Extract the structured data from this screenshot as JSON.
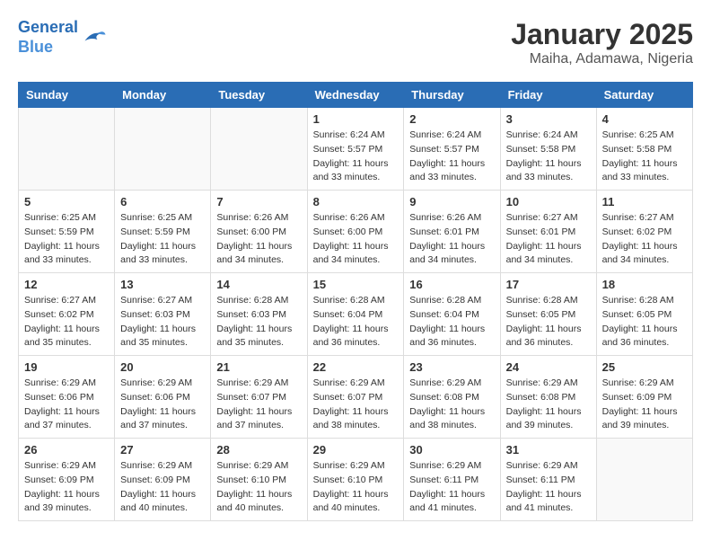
{
  "header": {
    "logo_line1": "General",
    "logo_line2": "Blue",
    "month_title": "January 2025",
    "location": "Maiha, Adamawa, Nigeria"
  },
  "days_of_week": [
    "Sunday",
    "Monday",
    "Tuesday",
    "Wednesday",
    "Thursday",
    "Friday",
    "Saturday"
  ],
  "weeks": [
    [
      {
        "day": "",
        "info": ""
      },
      {
        "day": "",
        "info": ""
      },
      {
        "day": "",
        "info": ""
      },
      {
        "day": "1",
        "info": "Sunrise: 6:24 AM\nSunset: 5:57 PM\nDaylight: 11 hours and 33 minutes."
      },
      {
        "day": "2",
        "info": "Sunrise: 6:24 AM\nSunset: 5:57 PM\nDaylight: 11 hours and 33 minutes."
      },
      {
        "day": "3",
        "info": "Sunrise: 6:24 AM\nSunset: 5:58 PM\nDaylight: 11 hours and 33 minutes."
      },
      {
        "day": "4",
        "info": "Sunrise: 6:25 AM\nSunset: 5:58 PM\nDaylight: 11 hours and 33 minutes."
      }
    ],
    [
      {
        "day": "5",
        "info": "Sunrise: 6:25 AM\nSunset: 5:59 PM\nDaylight: 11 hours and 33 minutes."
      },
      {
        "day": "6",
        "info": "Sunrise: 6:25 AM\nSunset: 5:59 PM\nDaylight: 11 hours and 33 minutes."
      },
      {
        "day": "7",
        "info": "Sunrise: 6:26 AM\nSunset: 6:00 PM\nDaylight: 11 hours and 34 minutes."
      },
      {
        "day": "8",
        "info": "Sunrise: 6:26 AM\nSunset: 6:00 PM\nDaylight: 11 hours and 34 minutes."
      },
      {
        "day": "9",
        "info": "Sunrise: 6:26 AM\nSunset: 6:01 PM\nDaylight: 11 hours and 34 minutes."
      },
      {
        "day": "10",
        "info": "Sunrise: 6:27 AM\nSunset: 6:01 PM\nDaylight: 11 hours and 34 minutes."
      },
      {
        "day": "11",
        "info": "Sunrise: 6:27 AM\nSunset: 6:02 PM\nDaylight: 11 hours and 34 minutes."
      }
    ],
    [
      {
        "day": "12",
        "info": "Sunrise: 6:27 AM\nSunset: 6:02 PM\nDaylight: 11 hours and 35 minutes."
      },
      {
        "day": "13",
        "info": "Sunrise: 6:27 AM\nSunset: 6:03 PM\nDaylight: 11 hours and 35 minutes."
      },
      {
        "day": "14",
        "info": "Sunrise: 6:28 AM\nSunset: 6:03 PM\nDaylight: 11 hours and 35 minutes."
      },
      {
        "day": "15",
        "info": "Sunrise: 6:28 AM\nSunset: 6:04 PM\nDaylight: 11 hours and 36 minutes."
      },
      {
        "day": "16",
        "info": "Sunrise: 6:28 AM\nSunset: 6:04 PM\nDaylight: 11 hours and 36 minutes."
      },
      {
        "day": "17",
        "info": "Sunrise: 6:28 AM\nSunset: 6:05 PM\nDaylight: 11 hours and 36 minutes."
      },
      {
        "day": "18",
        "info": "Sunrise: 6:28 AM\nSunset: 6:05 PM\nDaylight: 11 hours and 36 minutes."
      }
    ],
    [
      {
        "day": "19",
        "info": "Sunrise: 6:29 AM\nSunset: 6:06 PM\nDaylight: 11 hours and 37 minutes."
      },
      {
        "day": "20",
        "info": "Sunrise: 6:29 AM\nSunset: 6:06 PM\nDaylight: 11 hours and 37 minutes."
      },
      {
        "day": "21",
        "info": "Sunrise: 6:29 AM\nSunset: 6:07 PM\nDaylight: 11 hours and 37 minutes."
      },
      {
        "day": "22",
        "info": "Sunrise: 6:29 AM\nSunset: 6:07 PM\nDaylight: 11 hours and 38 minutes."
      },
      {
        "day": "23",
        "info": "Sunrise: 6:29 AM\nSunset: 6:08 PM\nDaylight: 11 hours and 38 minutes."
      },
      {
        "day": "24",
        "info": "Sunrise: 6:29 AM\nSunset: 6:08 PM\nDaylight: 11 hours and 39 minutes."
      },
      {
        "day": "25",
        "info": "Sunrise: 6:29 AM\nSunset: 6:09 PM\nDaylight: 11 hours and 39 minutes."
      }
    ],
    [
      {
        "day": "26",
        "info": "Sunrise: 6:29 AM\nSunset: 6:09 PM\nDaylight: 11 hours and 39 minutes."
      },
      {
        "day": "27",
        "info": "Sunrise: 6:29 AM\nSunset: 6:09 PM\nDaylight: 11 hours and 40 minutes."
      },
      {
        "day": "28",
        "info": "Sunrise: 6:29 AM\nSunset: 6:10 PM\nDaylight: 11 hours and 40 minutes."
      },
      {
        "day": "29",
        "info": "Sunrise: 6:29 AM\nSunset: 6:10 PM\nDaylight: 11 hours and 40 minutes."
      },
      {
        "day": "30",
        "info": "Sunrise: 6:29 AM\nSunset: 6:11 PM\nDaylight: 11 hours and 41 minutes."
      },
      {
        "day": "31",
        "info": "Sunrise: 6:29 AM\nSunset: 6:11 PM\nDaylight: 11 hours and 41 minutes."
      },
      {
        "day": "",
        "info": ""
      }
    ]
  ]
}
